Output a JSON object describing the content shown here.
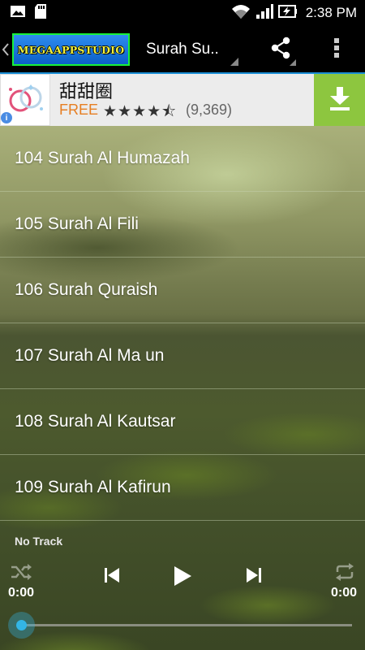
{
  "status_bar": {
    "time": "2:38 PM",
    "icons": [
      "image-icon",
      "sd-card-icon",
      "wifi-icon",
      "signal-icon",
      "battery-charging-icon"
    ]
  },
  "action_bar": {
    "logo_text": "MEGAAPPSTUDIO",
    "title": "Surah Su..",
    "icons": [
      "back-chevron-icon",
      "share-icon",
      "overflow-menu-icon"
    ]
  },
  "ad": {
    "app_name": "甜甜圈",
    "price": "FREE",
    "stars": "★★★★⯪",
    "rating_count": "(9,369)",
    "accent": "#8dc63f",
    "icons": [
      "rings-icon",
      "info-icon",
      "download-icon"
    ]
  },
  "list": {
    "items": [
      {
        "label": "104 Surah Al Humazah"
      },
      {
        "label": "105 Surah Al Fili"
      },
      {
        "label": "106 Surah Quraish"
      },
      {
        "label": "107 Surah Al Ma un"
      },
      {
        "label": "108 Surah Al Kautsar"
      },
      {
        "label": "109 Surah Al Kafirun"
      }
    ]
  },
  "player": {
    "track": "No Track",
    "elapsed": "0:00",
    "duration": "0:00",
    "progress": 0,
    "accent": "#33b5e5",
    "icons": [
      "shuffle-icon",
      "previous-icon",
      "play-icon",
      "next-icon",
      "repeat-icon"
    ]
  }
}
